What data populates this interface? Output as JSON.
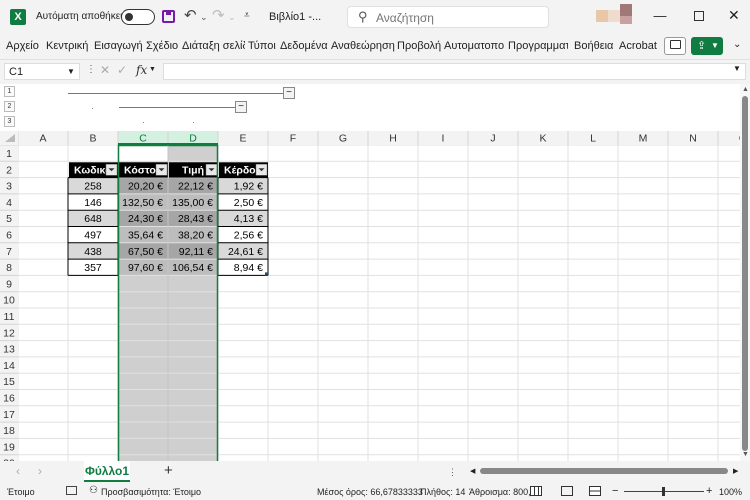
{
  "titlebar": {
    "app_icon_letter": "X",
    "autosave_label": "Αυτόματη αποθήκευση",
    "doc_title": "Βιβλίο1  -...",
    "search_placeholder": "Αναζήτηση"
  },
  "ribbon": {
    "tabs": [
      "Αρχείο",
      "Κεντρική",
      "Εισαγωγή",
      "Σχέδιο",
      "Διάταξη σελίδ",
      "Τύποι",
      "Δεδομένα",
      "Αναθεώρηση",
      "Προβολή",
      "Αυτοματοποί",
      "Προγραμματι",
      "Βοήθεια",
      "Acrobat"
    ]
  },
  "formula_bar": {
    "name_box": "C1",
    "fx_label": "fx",
    "formula": ""
  },
  "outline": {
    "levels": [
      "1",
      "2",
      "3"
    ]
  },
  "grid": {
    "columns": [
      "A",
      "B",
      "C",
      "D",
      "E",
      "F",
      "G",
      "H",
      "I",
      "J",
      "K",
      "L",
      "M",
      "N",
      "O"
    ],
    "rows": [
      "1",
      "2",
      "3",
      "4",
      "5",
      "6",
      "7",
      "8",
      "9",
      "10",
      "11",
      "12",
      "13",
      "14",
      "15",
      "16",
      "17",
      "18",
      "19",
      "20",
      "21",
      "22"
    ],
    "table_headers": [
      "Κωδικός",
      "Κόστος",
      "Τιμή",
      "Κέρδος"
    ],
    "table_rows": [
      [
        "258",
        "20,20 €",
        "22,12 €",
        "1,92 €"
      ],
      [
        "146",
        "132,50 €",
        "135,00 €",
        "2,50 €"
      ],
      [
        "648",
        "24,30 €",
        "28,43 €",
        "4,13 €"
      ],
      [
        "497",
        "35,64 €",
        "38,20 €",
        "2,56 €"
      ],
      [
        "438",
        "67,50 €",
        "92,11 €",
        "24,61 €"
      ],
      [
        "357",
        "97,60 €",
        "106,54 €",
        "8,94 €"
      ]
    ],
    "selection_fill": "#cfcfcf",
    "header_fill": "#000000",
    "accent": "#107c41"
  },
  "sheets": {
    "tabs": [
      "Φύλλο1"
    ],
    "add_label": "+"
  },
  "status": {
    "ready": "Έτοιμο",
    "accessibility": "Προσβασιμότητα: Έτοιμο",
    "average": "Μέσος όρος: 66,67833333",
    "count": "Πλήθος: 14",
    "sum": "Άθροισμα: 800,14",
    "zoom": "100%"
  }
}
